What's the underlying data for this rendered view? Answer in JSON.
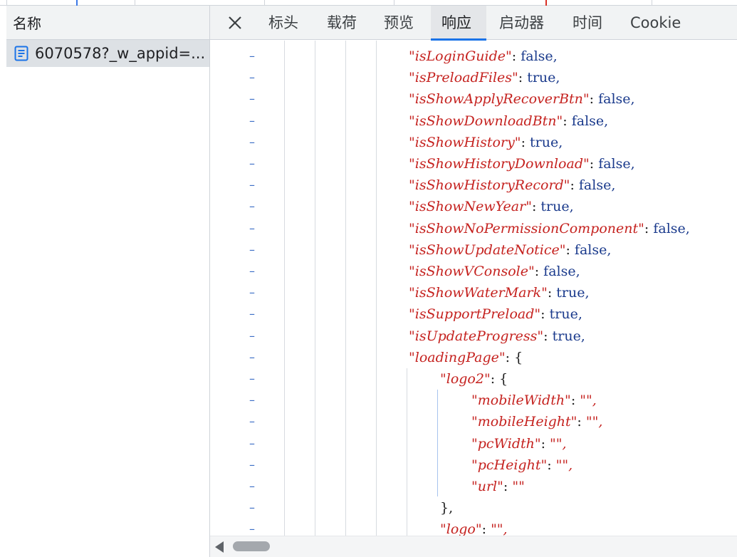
{
  "request_list": {
    "column_header": "名称",
    "selected_request": "6070578?_w_appid=...",
    "selected_icon": "document-icon"
  },
  "detail": {
    "close_icon": "close-icon",
    "tabs": [
      {
        "label": "标头",
        "active": false
      },
      {
        "label": "载荷",
        "active": false
      },
      {
        "label": "预览",
        "active": false
      },
      {
        "label": "响应",
        "active": true
      },
      {
        "label": "启动器",
        "active": false
      },
      {
        "label": "时间",
        "active": false
      },
      {
        "label": "Cookie",
        "active": false
      }
    ],
    "response_lines": [
      {
        "key": "\"isLoginGuide\"",
        "sep": ": ",
        "value": "false,"
      },
      {
        "key": "\"isPreloadFiles\"",
        "sep": ": ",
        "value": "true,"
      },
      {
        "key": "\"isShowApplyRecoverBtn\"",
        "sep": ": ",
        "value": "false,"
      },
      {
        "key": "\"isShowDownloadBtn\"",
        "sep": ": ",
        "value": "false,"
      },
      {
        "key": "\"isShowHistory\"",
        "sep": ": ",
        "value": "true,"
      },
      {
        "key": "\"isShowHistoryDownload\"",
        "sep": ": ",
        "value": "false,"
      },
      {
        "key": "\"isShowHistoryRecord\"",
        "sep": ": ",
        "value": "false,"
      },
      {
        "key": "\"isShowNewYear\"",
        "sep": ": ",
        "value": "true,"
      },
      {
        "key": "\"isShowNoPermissionComponent\"",
        "sep": ": ",
        "value": "false,"
      },
      {
        "key": "\"isShowUpdateNotice\"",
        "sep": ": ",
        "value": "false,"
      },
      {
        "key": "\"isShowVConsole\"",
        "sep": ": ",
        "value": "false,"
      },
      {
        "key": "\"isShowWaterMark\"",
        "sep": ": ",
        "value": "true,"
      },
      {
        "key": "\"isSupportPreload\"",
        "sep": ": ",
        "value": "true,"
      },
      {
        "key": "\"isUpdateProgress\"",
        "sep": ": ",
        "value": "true,"
      },
      {
        "key": "\"loadingPage\"",
        "sep": ": ",
        "value": "{"
      },
      {
        "key": "\"logo2\"",
        "sep": ": ",
        "value": "{"
      },
      {
        "key": "\"mobileWidth\"",
        "sep": ": ",
        "value": "\"\","
      },
      {
        "key": "\"mobileHeight\"",
        "sep": ": ",
        "value": "\"\","
      },
      {
        "key": "\"pcWidth\"",
        "sep": ": ",
        "value": "\"\","
      },
      {
        "key": "\"pcHeight\"",
        "sep": ": ",
        "value": "\"\","
      },
      {
        "key": "\"url\"",
        "sep": ": ",
        "value": "\"\""
      },
      {
        "key": "",
        "sep": "",
        "value": "},"
      },
      {
        "key": "\"logo\"",
        "sep": ": ",
        "value": "\"\","
      }
    ],
    "line_marker": "–"
  },
  "scrollbar": {
    "arrow_icon": "scroll-left-arrow-icon"
  }
}
